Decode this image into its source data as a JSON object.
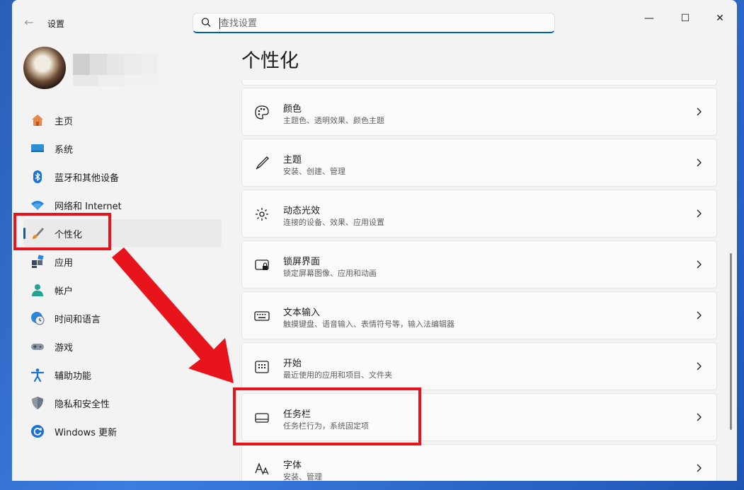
{
  "app": {
    "title": "设置"
  },
  "search": {
    "placeholder": "查找设置"
  },
  "window_controls": {
    "minimize": "—",
    "maximize": "☐",
    "close": "✕"
  },
  "sidebar": {
    "items": [
      {
        "label": "主页",
        "icon": "home-icon"
      },
      {
        "label": "系统",
        "icon": "monitor-icon"
      },
      {
        "label": "蓝牙和其他设备",
        "icon": "bluetooth-icon"
      },
      {
        "label": "网络和 Internet",
        "icon": "wifi-icon"
      },
      {
        "label": "个性化",
        "icon": "brush-icon",
        "active": true
      },
      {
        "label": "应用",
        "icon": "apps-icon"
      },
      {
        "label": "帐户",
        "icon": "person-icon"
      },
      {
        "label": "时间和语言",
        "icon": "clock-globe-icon"
      },
      {
        "label": "游戏",
        "icon": "gamepad-icon"
      },
      {
        "label": "辅助功能",
        "icon": "accessibility-icon"
      },
      {
        "label": "隐私和安全性",
        "icon": "shield-icon"
      },
      {
        "label": "Windows 更新",
        "icon": "update-icon"
      }
    ]
  },
  "main": {
    "title": "个性化",
    "cards": [
      {
        "title": "颜色",
        "subtitle": "主题色、透明效果、颜色主题",
        "icon": "palette-icon"
      },
      {
        "title": "主题",
        "subtitle": "安装、创建、管理",
        "icon": "pen-icon"
      },
      {
        "title": "动态光效",
        "subtitle": "连接的设备、效果、应用设置",
        "icon": "light-icon"
      },
      {
        "title": "锁屏界面",
        "subtitle": "锁定屏幕图像、应用和动画",
        "icon": "lock-screen-icon"
      },
      {
        "title": "文本输入",
        "subtitle": "触摸键盘、语音输入、表情符号等，输入法编辑器",
        "icon": "keyboard-icon"
      },
      {
        "title": "开始",
        "subtitle": "最近使用的应用和项目、文件夹",
        "icon": "start-icon"
      },
      {
        "title": "任务栏",
        "subtitle": "任务栏行为，系统固定项",
        "icon": "taskbar-icon"
      },
      {
        "title": "字体",
        "subtitle": "安装、管理",
        "icon": "font-icon"
      }
    ]
  },
  "colors": {
    "accent": "#005fb8",
    "highlight": "#e8141c"
  }
}
